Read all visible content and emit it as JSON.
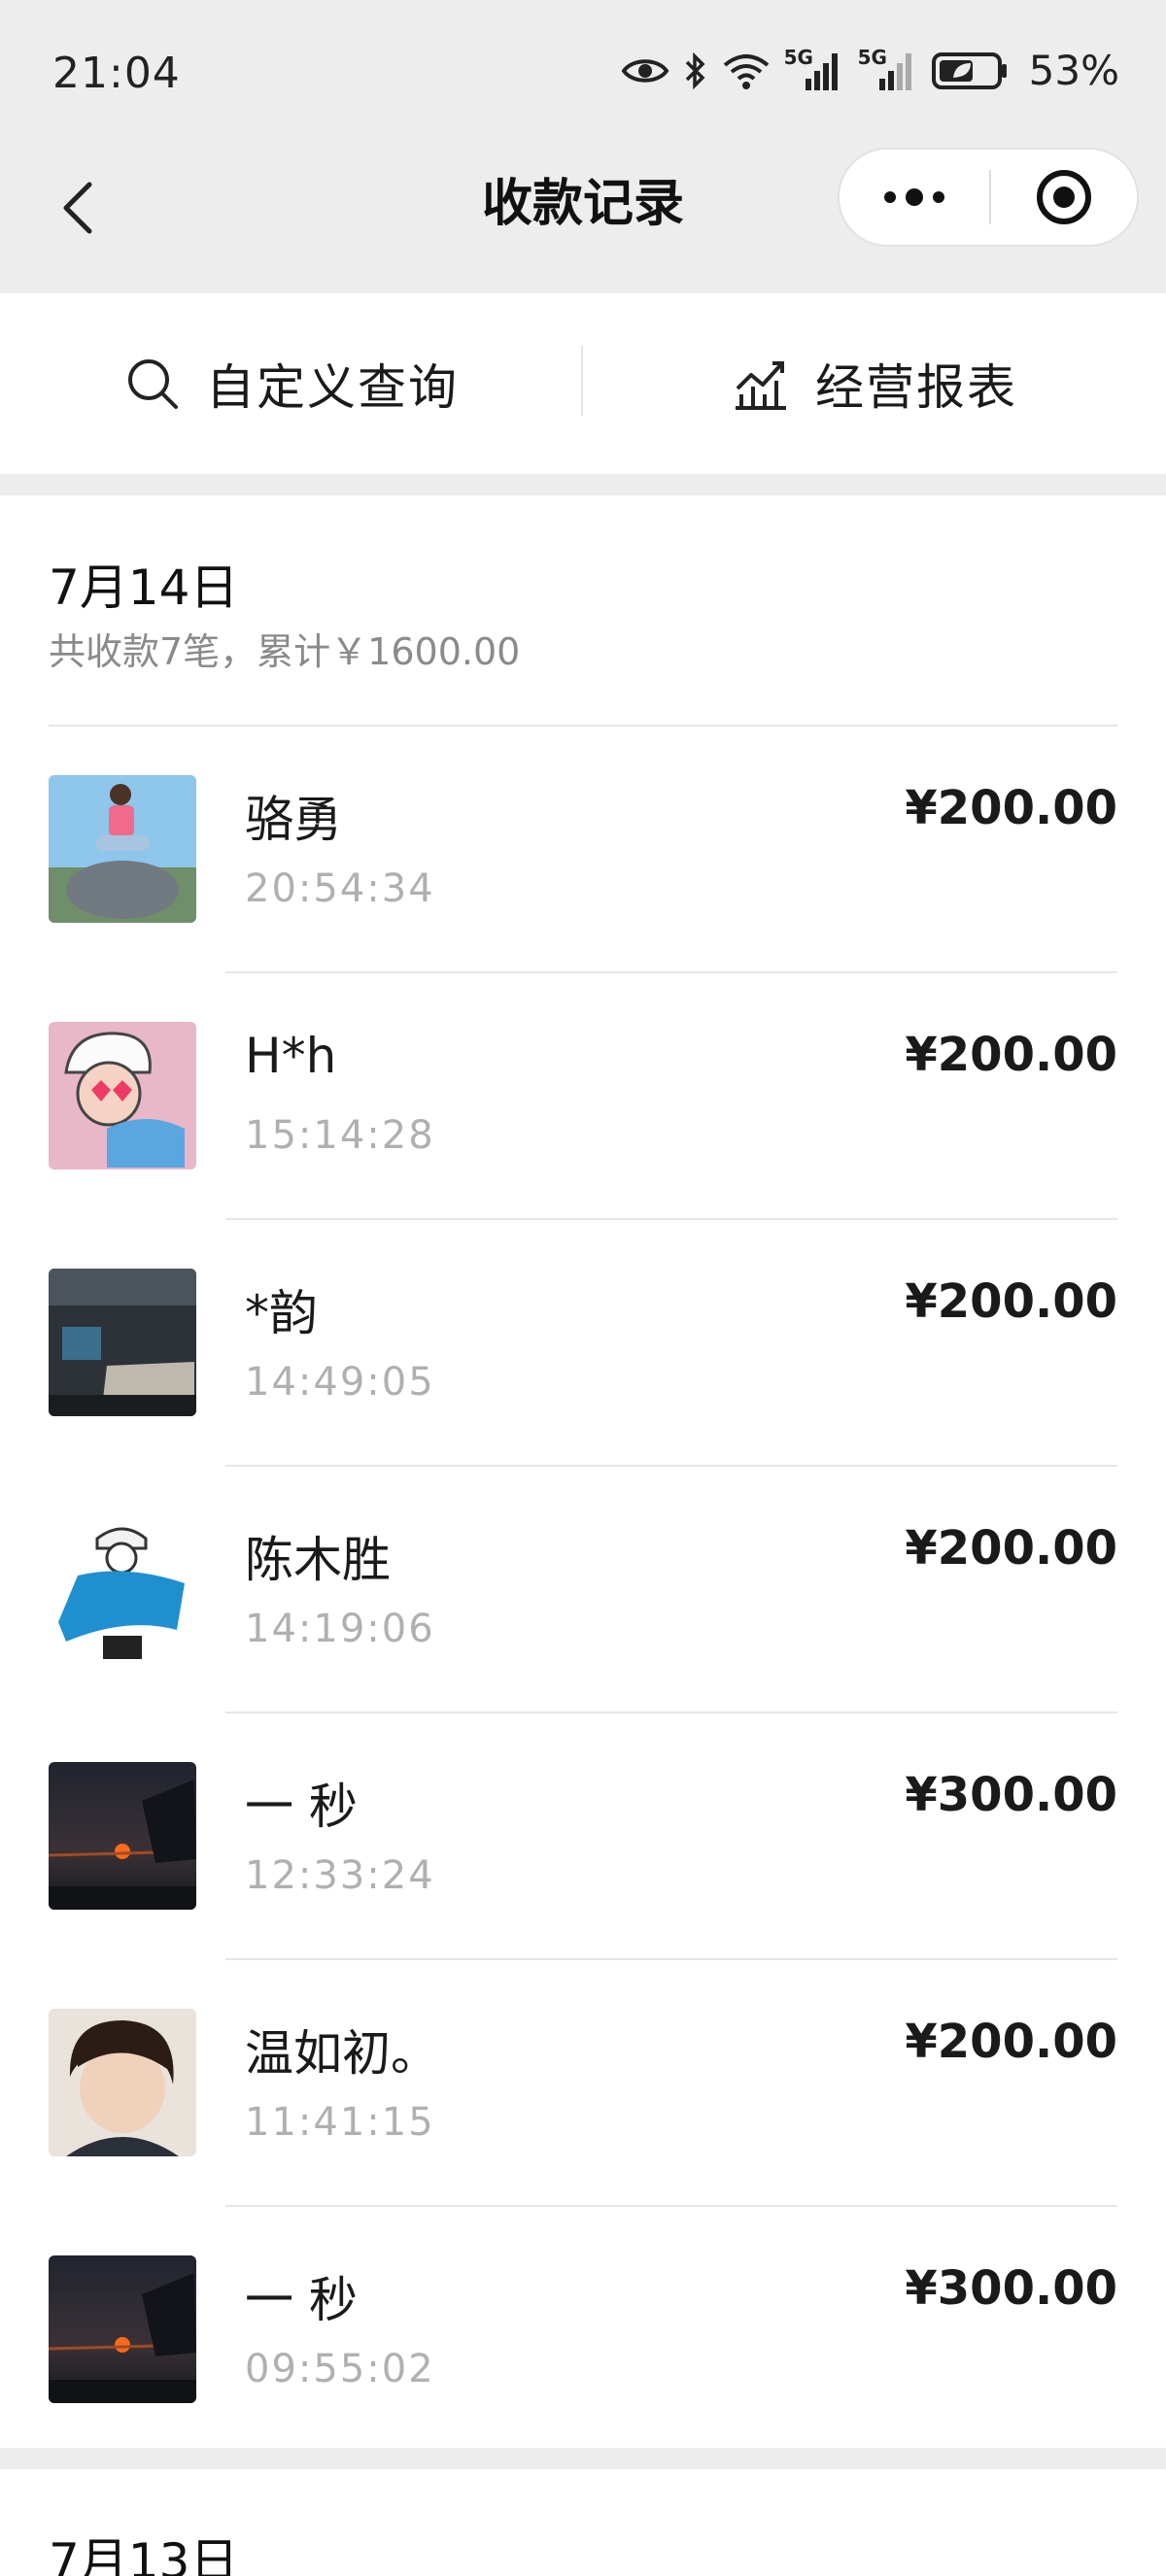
{
  "status_bar": {
    "time": "21:04",
    "signal1_label": "5G",
    "signal2_label": "5G",
    "battery_percent": "53%"
  },
  "nav": {
    "title": "收款记录"
  },
  "actions": {
    "custom_query_label": "自定义查询",
    "report_label": "经营报表"
  },
  "sections": [
    {
      "date": "7月14日",
      "summary": "共收款7笔，累计￥1600.00",
      "records": [
        {
          "name": "骆勇",
          "time": "20:54:34",
          "amount": "¥200.00"
        },
        {
          "name": "H*h",
          "time": "15:14:28",
          "amount": "¥200.00"
        },
        {
          "name": "*韵",
          "time": "14:49:05",
          "amount": "¥200.00"
        },
        {
          "name": "陈木胜",
          "time": "14:19:06",
          "amount": "¥200.00"
        },
        {
          "name": "一 秒",
          "time": "12:33:24",
          "amount": "¥300.00"
        },
        {
          "name": "温如初。",
          "time": "11:41:15",
          "amount": "¥200.00"
        },
        {
          "name": "一 秒",
          "time": "09:55:02",
          "amount": "¥300.00"
        }
      ]
    },
    {
      "date": "7月13日"
    }
  ],
  "colors": {
    "background": "#ededed",
    "card": "#ffffff",
    "secondary_text": "#8a8a8a",
    "time_text": "#b0b0b0",
    "divider": "#e6e6e6"
  }
}
